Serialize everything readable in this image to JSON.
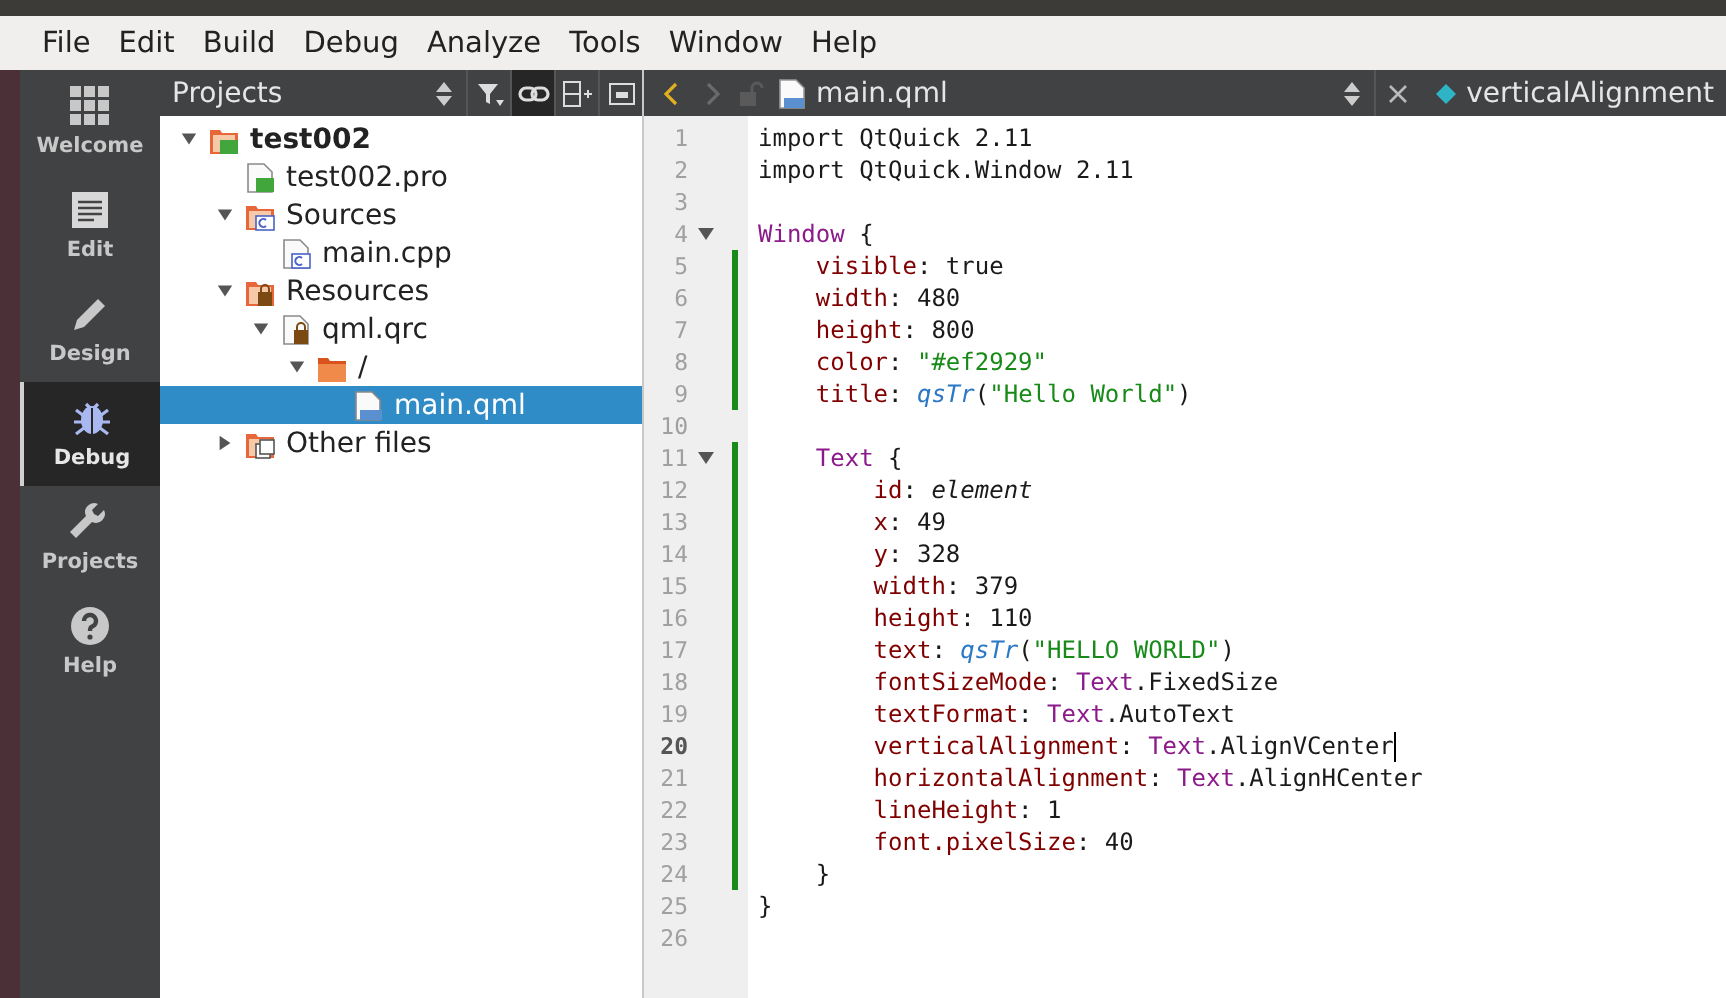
{
  "menu_bar": [
    "File",
    "Edit",
    "Build",
    "Debug",
    "Analyze",
    "Tools",
    "Window",
    "Help"
  ],
  "modes": [
    {
      "label": "Welcome",
      "kind": "grid",
      "selected": false
    },
    {
      "label": "Edit",
      "kind": "edit",
      "selected": false
    },
    {
      "label": "Design",
      "kind": "pencil",
      "selected": false
    },
    {
      "label": "Debug",
      "kind": "bug",
      "selected": true
    },
    {
      "label": "Projects",
      "kind": "wrench",
      "selected": false
    },
    {
      "label": "Help",
      "kind": "help",
      "selected": false
    }
  ],
  "projects_panel": {
    "title": "Projects",
    "link_toggled": true,
    "tree": [
      {
        "label": "test002",
        "kind": "project",
        "expanded": true,
        "selected": false,
        "children": [
          {
            "label": "test002.pro",
            "kind": "profile",
            "selected": false
          },
          {
            "label": "Sources",
            "kind": "sources",
            "expanded": true,
            "selected": false,
            "children": [
              {
                "label": "main.cpp",
                "kind": "cpp",
                "selected": false
              }
            ]
          },
          {
            "label": "Resources",
            "kind": "resources",
            "expanded": true,
            "selected": false,
            "children": [
              {
                "label": "qml.qrc",
                "kind": "qrc",
                "expanded": true,
                "selected": false,
                "children": [
                  {
                    "label": "/",
                    "kind": "folder",
                    "expanded": true,
                    "selected": false,
                    "children": [
                      {
                        "label": "main.qml",
                        "kind": "qml",
                        "selected": true
                      }
                    ]
                  }
                ]
              }
            ]
          },
          {
            "label": "Other files",
            "kind": "other",
            "expanded": false,
            "selected": false
          }
        ]
      }
    ]
  },
  "editor": {
    "file": "main.qml",
    "symbol": "verticalAlignment",
    "lines": [
      {
        "number": "1",
        "fold": false,
        "changed": false,
        "current": false,
        "tokens": [
          {
            "text": "import QtQuick 2.11",
            "kind": "plain"
          }
        ]
      },
      {
        "number": "2",
        "fold": false,
        "changed": false,
        "current": false,
        "tokens": [
          {
            "text": "import QtQuick.Window 2.11",
            "kind": "plain"
          }
        ]
      },
      {
        "number": "3",
        "fold": false,
        "changed": false,
        "current": false
      },
      {
        "number": "4",
        "fold": true,
        "changed": false,
        "current": false,
        "tokens": [
          {
            "text": "Window",
            "kind": "type"
          },
          {
            "text": " {",
            "kind": "plain"
          }
        ]
      },
      {
        "number": "5",
        "fold": false,
        "changed": true,
        "current": false,
        "tokens": [
          {
            "text": "    visible",
            "kind": "prop"
          },
          {
            "text": ": true",
            "kind": "plain"
          }
        ]
      },
      {
        "number": "6",
        "fold": false,
        "changed": true,
        "current": false,
        "tokens": [
          {
            "text": "    width",
            "kind": "prop"
          },
          {
            "text": ": 480",
            "kind": "plain"
          }
        ]
      },
      {
        "number": "7",
        "fold": false,
        "changed": true,
        "current": false,
        "tokens": [
          {
            "text": "    height",
            "kind": "prop"
          },
          {
            "text": ": 800",
            "kind": "plain"
          }
        ]
      },
      {
        "number": "8",
        "fold": false,
        "changed": true,
        "current": false,
        "tokens": [
          {
            "text": "    color",
            "kind": "prop"
          },
          {
            "text": ": ",
            "kind": "plain"
          },
          {
            "text": "\"#ef2929\"",
            "kind": "string"
          }
        ]
      },
      {
        "number": "9",
        "fold": false,
        "changed": true,
        "current": false,
        "tokens": [
          {
            "text": "    title",
            "kind": "prop"
          },
          {
            "text": ": ",
            "kind": "plain"
          },
          {
            "text": "qsTr",
            "kind": "func"
          },
          {
            "text": "(",
            "kind": "plain"
          },
          {
            "text": "\"Hello World\"",
            "kind": "string"
          },
          {
            "text": ")",
            "kind": "plain"
          }
        ]
      },
      {
        "number": "10",
        "fold": false,
        "changed": false,
        "current": false
      },
      {
        "number": "11",
        "fold": true,
        "changed": true,
        "current": false,
        "tokens": [
          {
            "text": "    Text",
            "kind": "type"
          },
          {
            "text": " {",
            "kind": "plain"
          }
        ]
      },
      {
        "number": "12",
        "fold": false,
        "changed": true,
        "current": false,
        "tokens": [
          {
            "text": "        id",
            "kind": "prop"
          },
          {
            "text": ": ",
            "kind": "plain"
          },
          {
            "text": "element",
            "kind": "id"
          }
        ]
      },
      {
        "number": "13",
        "fold": false,
        "changed": true,
        "current": false,
        "tokens": [
          {
            "text": "        x",
            "kind": "prop"
          },
          {
            "text": ": 49",
            "kind": "plain"
          }
        ]
      },
      {
        "number": "14",
        "fold": false,
        "changed": true,
        "current": false,
        "tokens": [
          {
            "text": "        y",
            "kind": "prop"
          },
          {
            "text": ": 328",
            "kind": "plain"
          }
        ]
      },
      {
        "number": "15",
        "fold": false,
        "changed": true,
        "current": false,
        "tokens": [
          {
            "text": "        width",
            "kind": "prop"
          },
          {
            "text": ": 379",
            "kind": "plain"
          }
        ]
      },
      {
        "number": "16",
        "fold": false,
        "changed": true,
        "current": false,
        "tokens": [
          {
            "text": "        height",
            "kind": "prop"
          },
          {
            "text": ": 110",
            "kind": "plain"
          }
        ]
      },
      {
        "number": "17",
        "fold": false,
        "changed": true,
        "current": false,
        "tokens": [
          {
            "text": "        text",
            "kind": "prop"
          },
          {
            "text": ": ",
            "kind": "plain"
          },
          {
            "text": "qsTr",
            "kind": "func"
          },
          {
            "text": "(",
            "kind": "plain"
          },
          {
            "text": "\"HELLO WORLD\"",
            "kind": "string"
          },
          {
            "text": ")",
            "kind": "plain"
          }
        ]
      },
      {
        "number": "18",
        "fold": false,
        "changed": true,
        "current": false,
        "tokens": [
          {
            "text": "        fontSizeMode",
            "kind": "prop"
          },
          {
            "text": ": ",
            "kind": "plain"
          },
          {
            "text": "Text",
            "kind": "type"
          },
          {
            "text": ".FixedSize",
            "kind": "plain"
          }
        ]
      },
      {
        "number": "19",
        "fold": false,
        "changed": true,
        "current": false,
        "tokens": [
          {
            "text": "        textFormat",
            "kind": "prop"
          },
          {
            "text": ": ",
            "kind": "plain"
          },
          {
            "text": "Text",
            "kind": "type"
          },
          {
            "text": ".AutoText",
            "kind": "plain"
          }
        ]
      },
      {
        "number": "20",
        "fold": false,
        "changed": true,
        "current": true,
        "tokens": [
          {
            "text": "        verticalAlignment",
            "kind": "prop"
          },
          {
            "text": ": ",
            "kind": "plain"
          },
          {
            "text": "Text",
            "kind": "type"
          },
          {
            "text": ".AlignVCenter",
            "kind": "plain"
          }
        ]
      },
      {
        "number": "21",
        "fold": false,
        "changed": true,
        "current": false,
        "tokens": [
          {
            "text": "        horizontalAlignment",
            "kind": "prop"
          },
          {
            "text": ": ",
            "kind": "plain"
          },
          {
            "text": "Text",
            "kind": "type"
          },
          {
            "text": ".AlignHCenter",
            "kind": "plain"
          }
        ]
      },
      {
        "number": "22",
        "fold": false,
        "changed": true,
        "current": false,
        "tokens": [
          {
            "text": "        lineHeight",
            "kind": "prop"
          },
          {
            "text": ": 1",
            "kind": "plain"
          }
        ]
      },
      {
        "number": "23",
        "fold": false,
        "changed": true,
        "current": false,
        "tokens": [
          {
            "text": "        font.pixelSize",
            "kind": "prop"
          },
          {
            "text": ": 40",
            "kind": "plain"
          }
        ]
      },
      {
        "number": "24",
        "fold": false,
        "changed": true,
        "current": false,
        "tokens": [
          {
            "text": "    }",
            "kind": "plain"
          }
        ]
      },
      {
        "number": "25",
        "fold": false,
        "changed": false,
        "current": false,
        "tokens": [
          {
            "text": "}",
            "kind": "plain"
          }
        ]
      },
      {
        "number": "26",
        "fold": false,
        "changed": false,
        "current": false
      }
    ]
  }
}
